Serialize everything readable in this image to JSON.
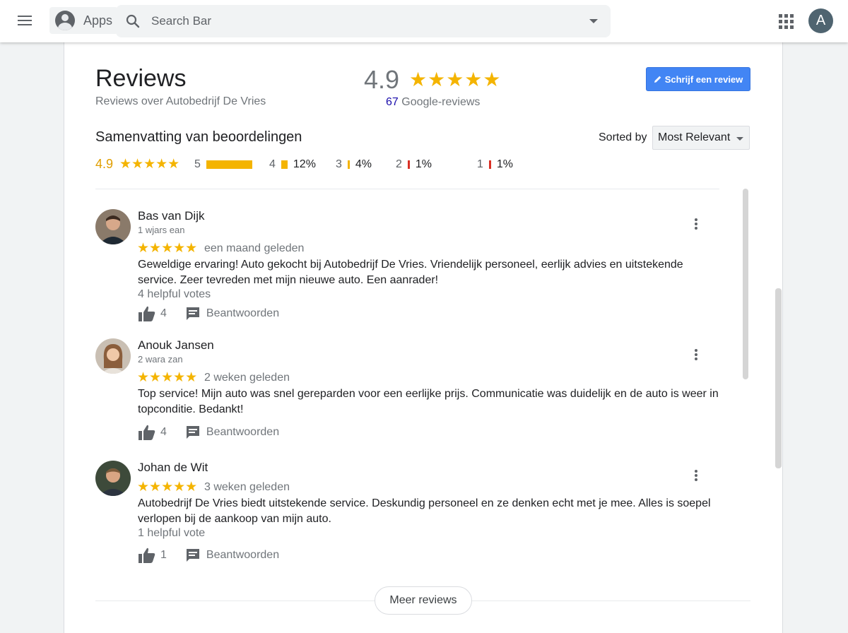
{
  "topbar": {
    "apps_label": "Apps",
    "search_placeholder": "Search Bar",
    "avatar_letter": "A"
  },
  "header": {
    "title": "Reviews",
    "subtitle": "Reviews over Autobedrijf De Vries",
    "rating": "4.9",
    "stars": "★★★★★",
    "review_count": "67",
    "review_count_suffix": " Google-reviews",
    "write_review_label": "Schrijf een review"
  },
  "summary": {
    "title": "Samenvatting van beoordelingen",
    "sorted_by_label": "Sorted by",
    "sort_value": "Most Relevant",
    "average": "4.9",
    "average_stars": "★★★★★",
    "distribution": [
      {
        "stars": "5",
        "percent_text": "",
        "fraction": 0.83
      },
      {
        "stars": "4",
        "percent_text": "12%",
        "fraction": 0.12
      },
      {
        "stars": "3",
        "percent_text": "4%",
        "fraction": 0.04
      },
      {
        "stars": "2",
        "percent_text": "1%",
        "fraction": 0.01
      },
      {
        "stars": "1",
        "percent_text": "1%",
        "fraction": 0.01
      }
    ]
  },
  "reviews": [
    {
      "name": "Bas van Dijk",
      "meta": "1 wjars ean",
      "stars": "★★★★★",
      "rating": 5,
      "when": "een maand geleden",
      "text": "Geweldige ervaring! Auto gekocht bij Autobedrijf De Vries. Vriendelijk personeel, eerlijk advies en uitstekende service. Zeer tevreden met mijn nieuwe auto. Een aanrader!",
      "votes_text": "4 helpful votes",
      "thumb_count": "4",
      "reply_label": "Beantwoorden"
    },
    {
      "name": "Anouk Jansen",
      "meta": "2 wara zan",
      "stars": "★★★★★",
      "rating": 5,
      "when": "2 weken geleden",
      "text": "Top service! Mijn auto was snel gereparden voor een eerlijke prijs. Communicatie was duidelijk en de auto is weer in topconditie. Bedankt!",
      "votes_text": "",
      "thumb_count": "4",
      "reply_label": "Beantwoorden"
    },
    {
      "name": "Johan de Wit",
      "meta": "",
      "stars": "★★★★★",
      "rating": 5,
      "when": "3 weken geleden",
      "text": "Autobedrijf De Vries biedt uitstekende service. Deskundig personeel en ze denken echt met je mee. Alles is soepel verlopen bij de aankoop van mijn auto.",
      "votes_text": "1 helpful vote",
      "thumb_count": "1",
      "reply_label": "Beantwoorden"
    }
  ],
  "more_reviews_label": "Meer reviews",
  "icons": {
    "menu": "hamburger-menu-icon",
    "search": "search-icon",
    "apps_grid": "apps-grid-icon",
    "thumb": "thumbs-up-icon",
    "reply": "comment-icon",
    "more": "more-vert-icon",
    "pencil": "pencil-icon"
  },
  "colors": {
    "star": "#f4b400",
    "accent_blue": "#4285f4",
    "link_blue": "#1a0dab",
    "low_rating_bar": "#d93025"
  }
}
